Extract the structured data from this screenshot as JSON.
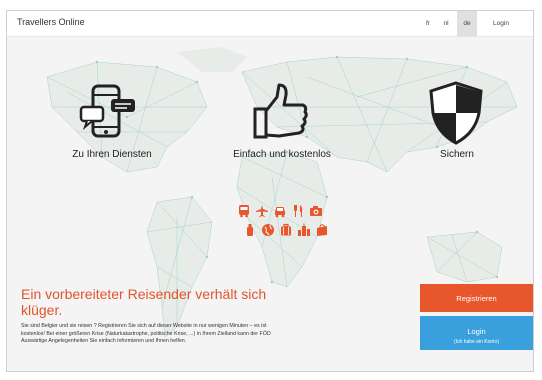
{
  "header": {
    "brand": "Travellers Online",
    "languages": [
      "fr",
      "nl",
      "de"
    ],
    "active_language": "de",
    "login_label": "Login"
  },
  "features": [
    {
      "label": "Zu Ihren Diensten",
      "icon": "phone-chat-icon"
    },
    {
      "label": "Einfach und kostenlos",
      "icon": "thumbs-up-icon"
    },
    {
      "label": "Sichern",
      "icon": "shield-icon"
    }
  ],
  "travel_icons": [
    "bus-icon",
    "airplane-icon",
    "car-icon",
    "restaurant-icon",
    "camera-icon",
    "bottle-icon",
    "globe-icon",
    "luggage-icon",
    "city-icon",
    "shopping-icon"
  ],
  "headline": "Ein vorbereiteter Reisender verhält sich klüger.",
  "description": "Sie sind Belgier und sie reisen ? Registrieren Sie sich auf dieser Website in nur wenigen Minuten – es ist kostenlos! Bei einer größeren Krise (Naturkatastrophe, politische Krise, ...) in Ihrem Zielland kann der FÖD Auswärtige Angelegenheiten Sie einfach informieren und Ihnen helfen.",
  "buttons": {
    "register": "Registrieren",
    "login": "Login",
    "login_sub": "(Ich habe ein Konto)"
  },
  "colors": {
    "accent": "#e8562c",
    "login_blue": "#3aa0dd",
    "map_line": "#9fd0c2"
  }
}
